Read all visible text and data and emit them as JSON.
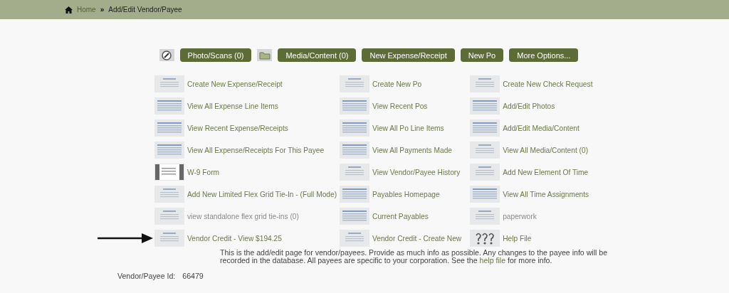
{
  "breadcrumb": {
    "home": "Home",
    "separator": "»",
    "current": "Add/Edit Vendor/Payee"
  },
  "toolbar": [
    {
      "kind": "icon"
    },
    {
      "kind": "button",
      "label": "Photo/Scans (0)"
    },
    {
      "kind": "icon"
    },
    {
      "kind": "button",
      "label": "Media/Content (0)"
    },
    {
      "kind": "button",
      "label": "New Expense/Receipt"
    },
    {
      "kind": "button",
      "label": "New Po"
    },
    {
      "kind": "button",
      "label": "More Options..."
    }
  ],
  "links": [
    [
      {
        "label": "Create New Expense/Receipt",
        "muted": false,
        "pointer": false
      },
      {
        "label": "View All Expense Line Items",
        "muted": false,
        "pointer": false
      },
      {
        "label": "View Recent Expense/Receipts",
        "muted": false,
        "pointer": false
      },
      {
        "label": "View All Expense/Receipts For This Payee",
        "muted": false,
        "pointer": false
      },
      {
        "label": "W-9 Form",
        "muted": false,
        "pointer": false
      },
      {
        "label": "Add New Limited Flex Grid Tie-In - (Full Mode)",
        "muted": false,
        "pointer": false
      },
      {
        "label": "view standalone flex grid tie-ins (0)",
        "muted": true,
        "pointer": false
      },
      {
        "label": "Vendor Credit - View $194.25",
        "muted": false,
        "pointer": true
      }
    ],
    [
      {
        "label": "Create New Po",
        "muted": false,
        "pointer": false
      },
      {
        "label": "View Recent Pos",
        "muted": false,
        "pointer": false
      },
      {
        "label": "View All Po Line Items",
        "muted": false,
        "pointer": false
      },
      {
        "label": "View All Payments Made",
        "muted": false,
        "pointer": false
      },
      {
        "label": "View Vendor/Payee History",
        "muted": false,
        "pointer": false
      },
      {
        "label": "Payables Homepage",
        "muted": false,
        "pointer": false
      },
      {
        "label": "Current Payables",
        "muted": false,
        "pointer": false
      },
      {
        "label": "Vendor Credit - Create New",
        "muted": false,
        "pointer": false
      }
    ],
    [
      {
        "label": "Create New Check Request",
        "muted": false,
        "pointer": false
      },
      {
        "label": "Add/Edit Photos",
        "muted": false,
        "pointer": false
      },
      {
        "label": "Add/Edit Media/Content",
        "muted": false,
        "pointer": false
      },
      {
        "label": "View All Media/Content (0)",
        "muted": false,
        "pointer": false
      },
      {
        "label": "Add New Element Of Time",
        "muted": false,
        "pointer": false
      },
      {
        "label": "View All Time Assignments",
        "muted": false,
        "pointer": false
      },
      {
        "label": "paperwork",
        "muted": true,
        "pointer": false
      },
      {
        "label": "Help File",
        "muted": false,
        "pointer": false
      }
    ]
  ],
  "description": {
    "before": "This is the add/edit page for vendor/payees. Provide as much info as possible. Any changes to the payee info will be recorded in the database. All payees are specific to your corporation. See the",
    "link": "help file",
    "after": "for more info."
  },
  "vendor_id": {
    "label": "Vendor/Payee Id:",
    "value": "66479"
  }
}
